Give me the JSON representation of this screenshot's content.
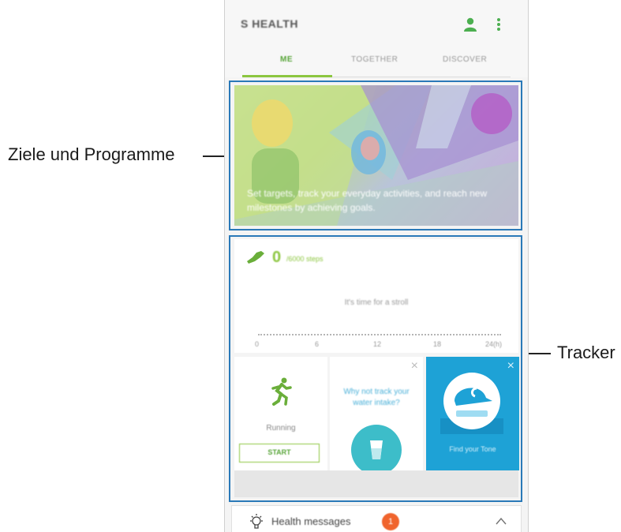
{
  "callouts": {
    "left": "Ziele und Programme",
    "right": "Tracker"
  },
  "app": {
    "title": "S HEALTH",
    "tabs": [
      {
        "label": "ME",
        "active": true
      },
      {
        "label": "TOGETHER",
        "active": false
      },
      {
        "label": "DISCOVER",
        "active": false
      }
    ]
  },
  "banner": {
    "text": "Set targets, track your everyday activities, and reach new milestones by achieving goals."
  },
  "steps": {
    "value": "0",
    "goal": "/6000 steps",
    "message": "It's time for a stroll",
    "axis": [
      "0",
      "6",
      "12",
      "18",
      "24(h)"
    ]
  },
  "cards": {
    "running": {
      "label": "Running",
      "button": "START"
    },
    "water": {
      "message": "Why not track your water intake?"
    },
    "cigna": {
      "text": "Find your Tone"
    }
  },
  "messages": {
    "label": "Health messages",
    "count": "1"
  },
  "colors": {
    "accent": "#8cc63f",
    "highlight": "#2a79b8",
    "cigna_blue": "#1ea2d6",
    "badge": "#f0642d"
  }
}
